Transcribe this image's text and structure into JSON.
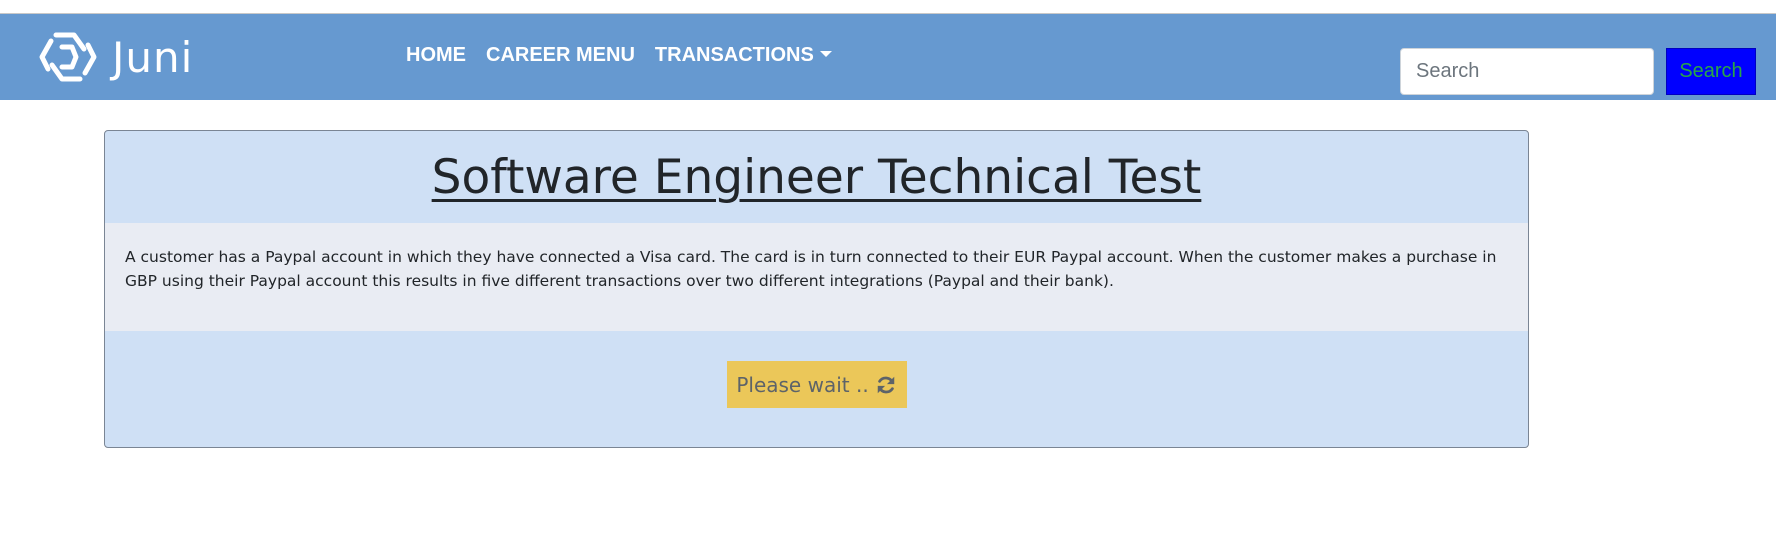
{
  "navbar": {
    "brand": {
      "name": "Juni",
      "icon": "juni-logo-icon"
    },
    "links": [
      {
        "label": "HOME"
      },
      {
        "label": "CAREER MENU"
      },
      {
        "label": "TRANSACTIONS",
        "dropdown": true
      }
    ],
    "search": {
      "placeholder": "Search",
      "value": "",
      "button_label": "Search"
    }
  },
  "card": {
    "title": "Software Engineer Technical Test",
    "description": "A customer has a Paypal account in which they have connected a Visa card. The card is in turn connected to their EUR Paypal account. When the customer makes a purchase in GBP using their Paypal account this results in five different transactions over two different integrations (Paypal and their bank).",
    "button": {
      "label": "Please wait ..",
      "icon": "refresh-icon"
    }
  },
  "colors": {
    "navbar_bg": "#6699d0",
    "card_bg": "#cfe0f5",
    "card_body_bg": "#e9ecf3",
    "wait_button_bg": "#ebc759",
    "search_button_bg": "#0000ff",
    "search_button_text": "#28a745"
  }
}
